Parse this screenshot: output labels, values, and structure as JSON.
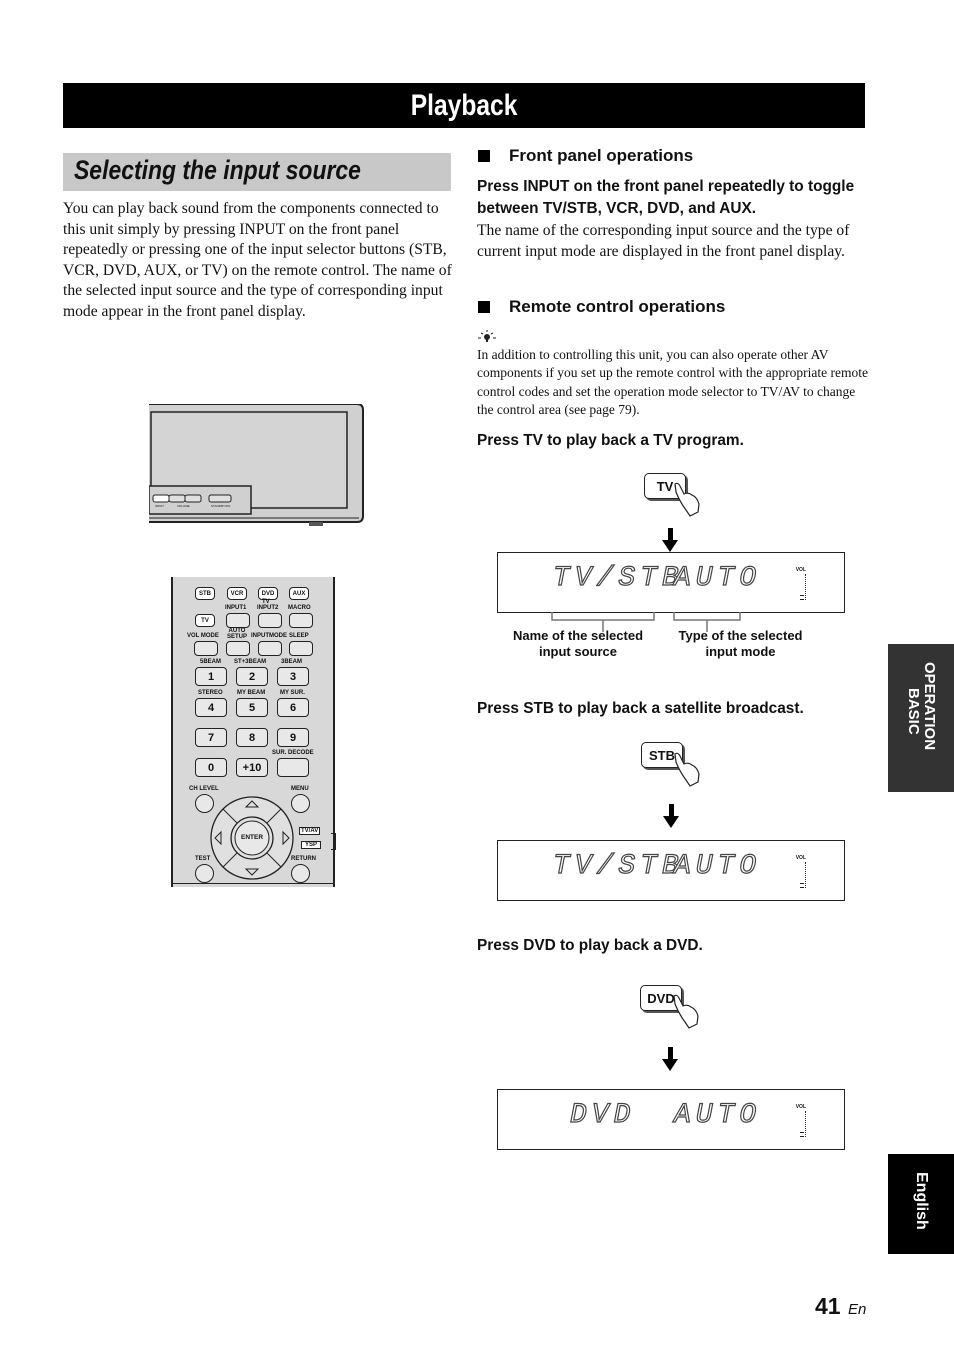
{
  "page": {
    "title": "Playback",
    "page_number": "41",
    "page_lang_suffix": "En"
  },
  "left": {
    "section_title": "Selecting the input source",
    "intro": "You can play back sound from the components connected to this unit simply by pressing INPUT on the front panel repeatedly or pressing one of the input selector buttons (STB, VCR, DVD, AUX, or TV) on the remote control. The name of the selected input source and the type of corresponding input mode appear in the front panel display.",
    "front_panel_labels": [
      "INPUT",
      "VOLUME",
      "STANDBY/ON"
    ],
    "remote": {
      "row1": [
        "STB",
        "VCR",
        "DVD",
        "AUX"
      ],
      "tv_group_label": "TV",
      "row2_labels": [
        "INPUT1",
        "INPUT2",
        "MACRO"
      ],
      "tv_button": "TV",
      "row3_labels": [
        "VOL MODE",
        "AUTO SETUP",
        "INPUTMODE",
        "SLEEP"
      ],
      "row4_labels": [
        "5BEAM",
        "ST+3BEAM",
        "3BEAM"
      ],
      "row4_keys": [
        "1",
        "2",
        "3"
      ],
      "row5_labels": [
        "STEREO",
        "MY BEAM",
        "MY SUR."
      ],
      "row5_keys": [
        "4",
        "5",
        "6"
      ],
      "row6_keys": [
        "7",
        "8",
        "9"
      ],
      "row7_label": "SUR. DECODE",
      "row7_keys": [
        "0",
        "+10"
      ],
      "ch_level": "CH LEVEL",
      "menu": "MENU",
      "enter": "ENTER",
      "test": "TEST",
      "return": "RETURN",
      "tv_av": "TV/AV",
      "ysp": "YSP"
    }
  },
  "right": {
    "front_panel": {
      "heading": "Front panel operations",
      "instruction": "Press INPUT on the front panel repeatedly to toggle between TV/STB, VCR, DVD, and AUX.",
      "body": "The name of the corresponding input source and the type of current input mode are displayed in the front panel display."
    },
    "remote_ops": {
      "heading": "Remote control operations",
      "tip": "In addition to controlling this unit, you can also operate other AV components if you set up the remote control with the appropriate remote control codes and set the operation mode selector to TV/AV to change the control area (see page 79)."
    },
    "steps": [
      {
        "instruction": "Press TV to play back a TV program.",
        "button": "TV",
        "display_source": "TV/STB",
        "display_mode": "AUTO",
        "vol_label": "VOL",
        "caption_source": "Name of the selected input source",
        "caption_mode": "Type of the selected input mode"
      },
      {
        "instruction": "Press STB to play back a satellite broadcast.",
        "button": "STB",
        "display_source": "TV/STB",
        "display_mode": "AUTO",
        "vol_label": "VOL"
      },
      {
        "instruction": "Press DVD to play back a DVD.",
        "button": "DVD",
        "display_source": "DVD",
        "display_mode": "AUTO",
        "vol_label": "VOL"
      }
    ]
  },
  "side_tabs": {
    "section": "BASIC OPERATION",
    "section_line1": "BASIC",
    "section_line2": "OPERATION",
    "language": "English"
  }
}
